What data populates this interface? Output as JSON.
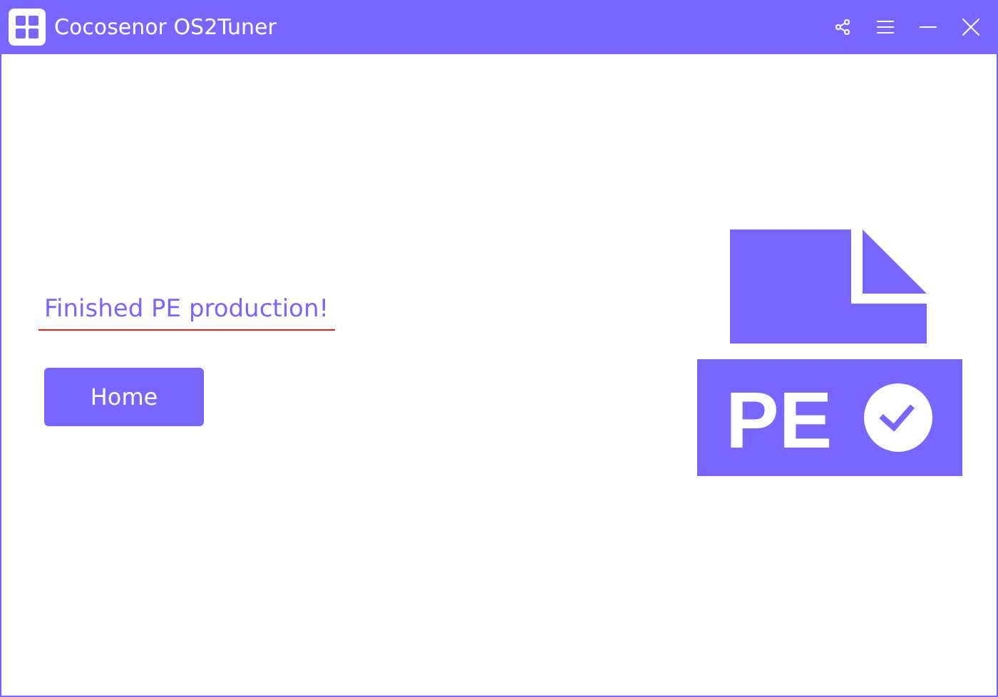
{
  "window": {
    "title": "Cocosenor OS2Tuner"
  },
  "message": "Finished PE production!",
  "buttons": [
    "Home"
  ],
  "illustration": {
    "badge": "PE"
  }
}
